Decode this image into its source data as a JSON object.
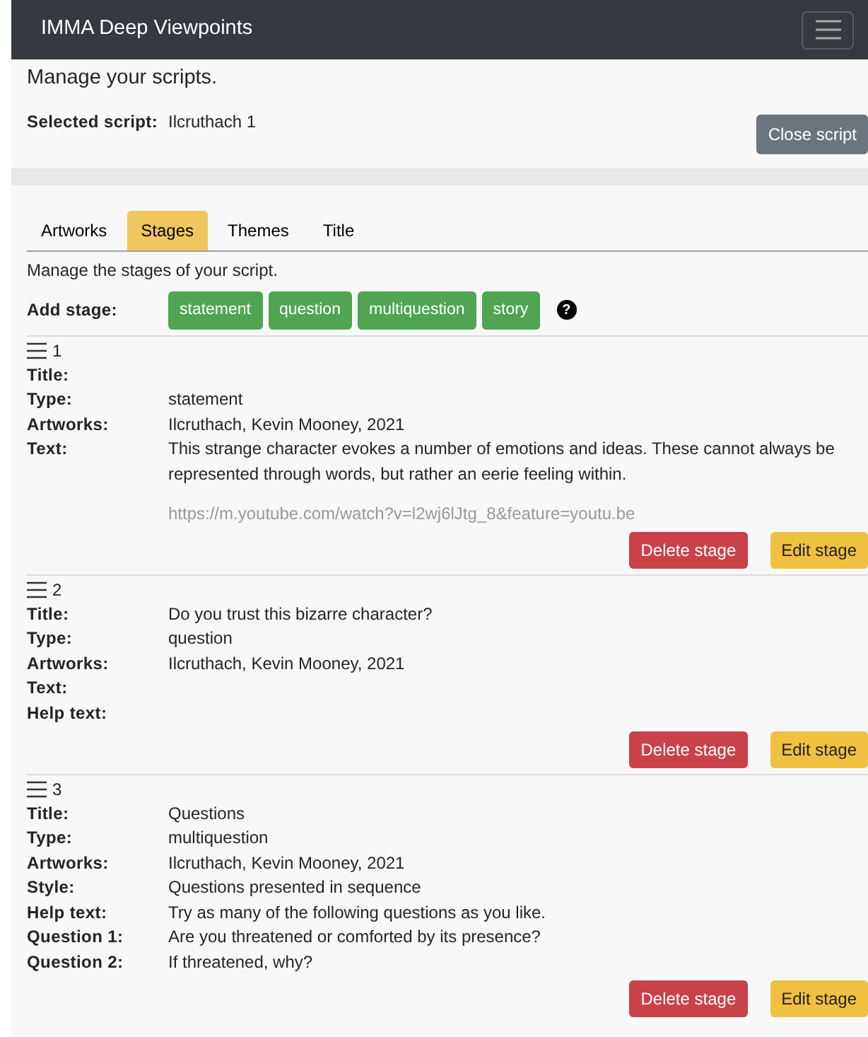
{
  "navbar": {
    "brand": "IMMA Deep Viewpoints"
  },
  "intro": "Manage your scripts.",
  "selected_script": {
    "label": "Selected script:",
    "value": "Ilcruthach 1",
    "close_button": "Close script"
  },
  "tabs": [
    {
      "label": "Artworks",
      "selected": false
    },
    {
      "label": "Stages",
      "selected": true
    },
    {
      "label": "Themes",
      "selected": false
    },
    {
      "label": "Title",
      "selected": false
    }
  ],
  "stages_intro": "Manage the stages of your script.",
  "add_stage": {
    "label": "Add stage:",
    "buttons": [
      "statement",
      "question",
      "multiquestion",
      "story"
    ],
    "help_icon": "?"
  },
  "stages": [
    {
      "number": "1",
      "fields": [
        {
          "label": "Title:"
        },
        {
          "label": "Type:",
          "value": "statement"
        },
        {
          "label": "Artworks:",
          "value": "Ilcruthach, Kevin Mooney, 2021"
        },
        {
          "label": "Text:",
          "value": "This strange character evokes a number of emotions and ideas. These cannot always be represented through words, but rather an eerie feeling within."
        }
      ],
      "url": "https://m.youtube.com/watch?v=l2wj6lJtg_8&feature=youtu.be",
      "delete_button": "Delete stage",
      "edit_button": "Edit stage"
    },
    {
      "number": "2",
      "fields": [
        {
          "label": "Title:",
          "value": "Do you trust this bizarre character?"
        },
        {
          "label": "Type:",
          "value": "question"
        },
        {
          "label": "Artworks:",
          "value": "Ilcruthach, Kevin Mooney, 2021"
        },
        {
          "label": "Text:"
        },
        {
          "label": "Help text:"
        }
      ],
      "delete_button": "Delete stage",
      "edit_button": "Edit stage"
    },
    {
      "number": "3",
      "fields": [
        {
          "label": "Title:",
          "value": "Questions"
        },
        {
          "label": "Type:",
          "value": "multiquestion"
        },
        {
          "label": "Artworks:",
          "value": "Ilcruthach, Kevin Mooney, 2021"
        },
        {
          "label": "Style:",
          "value": "Questions presented in sequence"
        },
        {
          "label": "Help text:",
          "value": "Try as many of the following questions as you like."
        },
        {
          "label": "Question 1:",
          "value": "Are you threatened or comforted by its presence?"
        },
        {
          "label": "Question 2:",
          "value": "If threatened, why?"
        }
      ],
      "delete_button": "Delete stage",
      "edit_button": "Edit stage"
    }
  ]
}
